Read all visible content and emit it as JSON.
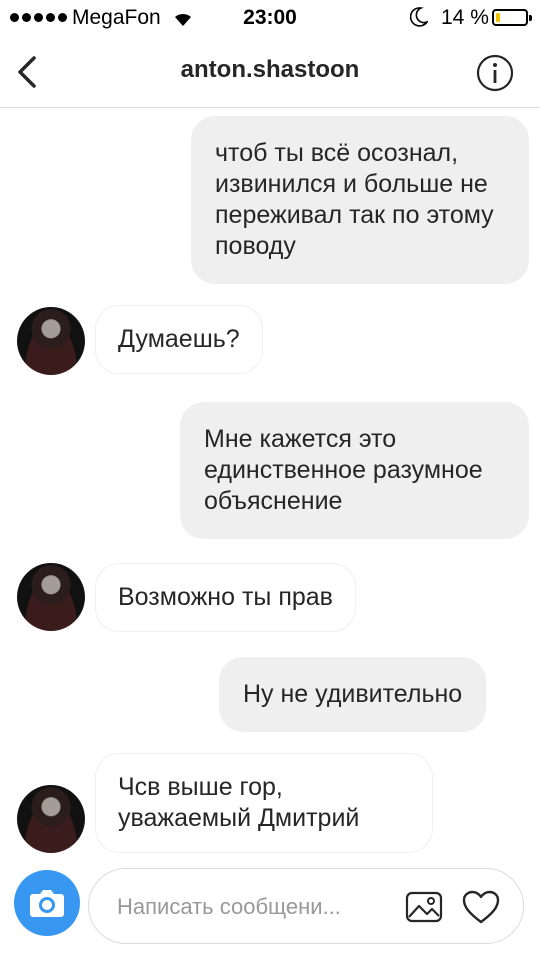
{
  "status_bar": {
    "carrier": "MegaFon",
    "time": "23:00",
    "battery_percent": "14 %",
    "battery_level": 0.14,
    "signal_bars": 5
  },
  "header": {
    "title": "anton.shastoon",
    "back_icon": "chevron-left-icon",
    "info_icon": "info-icon"
  },
  "messages": [
    {
      "side": "out",
      "text": "чтоб ты всё осознал, извинился и больше не переживал так по этому поводу"
    },
    {
      "side": "in",
      "text": "Думаешь?"
    },
    {
      "side": "out",
      "text": "Мне кажется это единственное разумное объяснение"
    },
    {
      "side": "in",
      "text": "Возможно ты прав"
    },
    {
      "side": "out",
      "text": "Ну не удивительно"
    },
    {
      "side": "in",
      "text": "Чсв выше гор, уважаемый Дмитрий"
    }
  ],
  "composer": {
    "placeholder": "Написать сообщени...",
    "camera_icon": "camera-icon",
    "gallery_icon": "image-icon",
    "like_icon": "heart-icon"
  },
  "colors": {
    "accent": "#3897f0",
    "outgoing_bubble": "#efefef",
    "incoming_border": "#efefef",
    "battery_fill": "#f2c200",
    "text": "#262626",
    "placeholder": "#999999"
  }
}
